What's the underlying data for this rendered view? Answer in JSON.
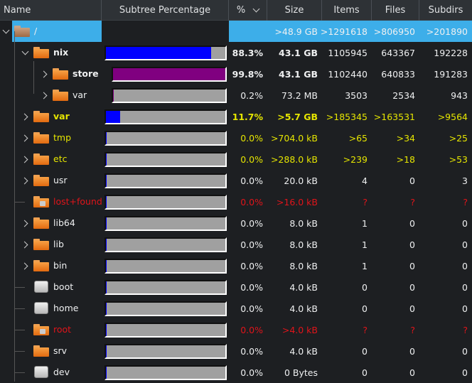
{
  "header": {
    "name": "Name",
    "subtree": "Subtree Percentage",
    "percent": "%",
    "size": "Size",
    "items": "Items",
    "files": "Files",
    "subdirs": "Subdirs",
    "sort_icon": "chevron-down-icon"
  },
  "colors": {
    "selection": "#3daee9",
    "depth1_bar": "#0000ff",
    "depth2_bar": "#800080",
    "bar_bg": "#a0a0a0",
    "pending": "#e5e500",
    "error": "#e0141a"
  },
  "rows": [
    {
      "name": "/",
      "depth": 0,
      "expander": "expanded",
      "icon": "folder",
      "percent": "",
      "fill": null,
      "size": ">48.9 GB",
      "items": ">1291618",
      "files": ">806950",
      "subdirs": ">201890",
      "style": "selected"
    },
    {
      "name": "nix",
      "depth": 1,
      "expander": "expanded",
      "icon": "folder",
      "percent": "88.3%",
      "fill": 88.3,
      "size": "43.1 GB",
      "items": "1105945",
      "files": "643367",
      "subdirs": "192228",
      "style": "bold"
    },
    {
      "name": "store",
      "depth": 2,
      "expander": "collapsed",
      "icon": "folder",
      "percent": "99.8%",
      "fill": 99.8,
      "size": "43.1 GB",
      "items": "1102440",
      "files": "640833",
      "subdirs": "191283",
      "style": "bold"
    },
    {
      "name": "var",
      "depth": 2,
      "expander": "collapsed",
      "icon": "folder",
      "percent": "0.2%",
      "fill": 0.2,
      "size": "73.2 MB",
      "items": "3503",
      "files": "2534",
      "subdirs": "943",
      "style": "normal"
    },
    {
      "name": "var",
      "depth": 1,
      "expander": "collapsed",
      "icon": "folder",
      "percent": "11.7%",
      "fill": 11.7,
      "size": ">5.7 GB",
      "items": ">185345",
      "files": ">163531",
      "subdirs": ">9564",
      "style": "yellow-bold"
    },
    {
      "name": "tmp",
      "depth": 1,
      "expander": "collapsed",
      "icon": "folder",
      "percent": "0.0%",
      "fill": 0,
      "size": ">704.0 kB",
      "items": ">65",
      "files": ">34",
      "subdirs": ">25",
      "style": "yellow"
    },
    {
      "name": "etc",
      "depth": 1,
      "expander": "collapsed",
      "icon": "folder",
      "percent": "0.0%",
      "fill": 0,
      "size": ">288.0 kB",
      "items": ">239",
      "files": ">18",
      "subdirs": ">53",
      "style": "yellow"
    },
    {
      "name": "usr",
      "depth": 1,
      "expander": "collapsed",
      "icon": "folder",
      "percent": "0.0%",
      "fill": 0,
      "size": "20.0 kB",
      "items": "4",
      "files": "0",
      "subdirs": "3",
      "style": "normal"
    },
    {
      "name": "lost+found",
      "depth": 1,
      "expander": "none",
      "icon": "locked-folder",
      "percent": "0.0%",
      "fill": 0,
      "size": ">16.0 kB",
      "items": "?",
      "files": "?",
      "subdirs": "?",
      "style": "red"
    },
    {
      "name": "lib64",
      "depth": 1,
      "expander": "collapsed",
      "icon": "folder",
      "percent": "0.0%",
      "fill": 0,
      "size": "8.0 kB",
      "items": "1",
      "files": "0",
      "subdirs": "0",
      "style": "normal"
    },
    {
      "name": "lib",
      "depth": 1,
      "expander": "collapsed",
      "icon": "folder",
      "percent": "0.0%",
      "fill": 0,
      "size": "8.0 kB",
      "items": "1",
      "files": "0",
      "subdirs": "0",
      "style": "normal"
    },
    {
      "name": "bin",
      "depth": 1,
      "expander": "collapsed",
      "icon": "folder",
      "percent": "0.0%",
      "fill": 0,
      "size": "8.0 kB",
      "items": "1",
      "files": "0",
      "subdirs": "0",
      "style": "normal"
    },
    {
      "name": "boot",
      "depth": 1,
      "expander": "none",
      "icon": "drive",
      "percent": "0.0%",
      "fill": 0,
      "size": "4.0 kB",
      "items": "0",
      "files": "0",
      "subdirs": "0",
      "style": "normal"
    },
    {
      "name": "home",
      "depth": 1,
      "expander": "none",
      "icon": "drive",
      "percent": "0.0%",
      "fill": 0,
      "size": "4.0 kB",
      "items": "0",
      "files": "0",
      "subdirs": "0",
      "style": "normal"
    },
    {
      "name": "root",
      "depth": 1,
      "expander": "none",
      "icon": "locked-folder",
      "percent": "0.0%",
      "fill": 0,
      "size": ">4.0 kB",
      "items": "?",
      "files": "?",
      "subdirs": "?",
      "style": "red"
    },
    {
      "name": "srv",
      "depth": 1,
      "expander": "none",
      "icon": "folder",
      "percent": "0.0%",
      "fill": 0,
      "size": "4.0 kB",
      "items": "0",
      "files": "0",
      "subdirs": "0",
      "style": "normal"
    },
    {
      "name": "dev",
      "depth": 1,
      "expander": "none",
      "icon": "drive",
      "percent": "0.0%",
      "fill": 0,
      "size": "0 Bytes",
      "items": "0",
      "files": "0",
      "subdirs": "0",
      "style": "normal"
    }
  ]
}
